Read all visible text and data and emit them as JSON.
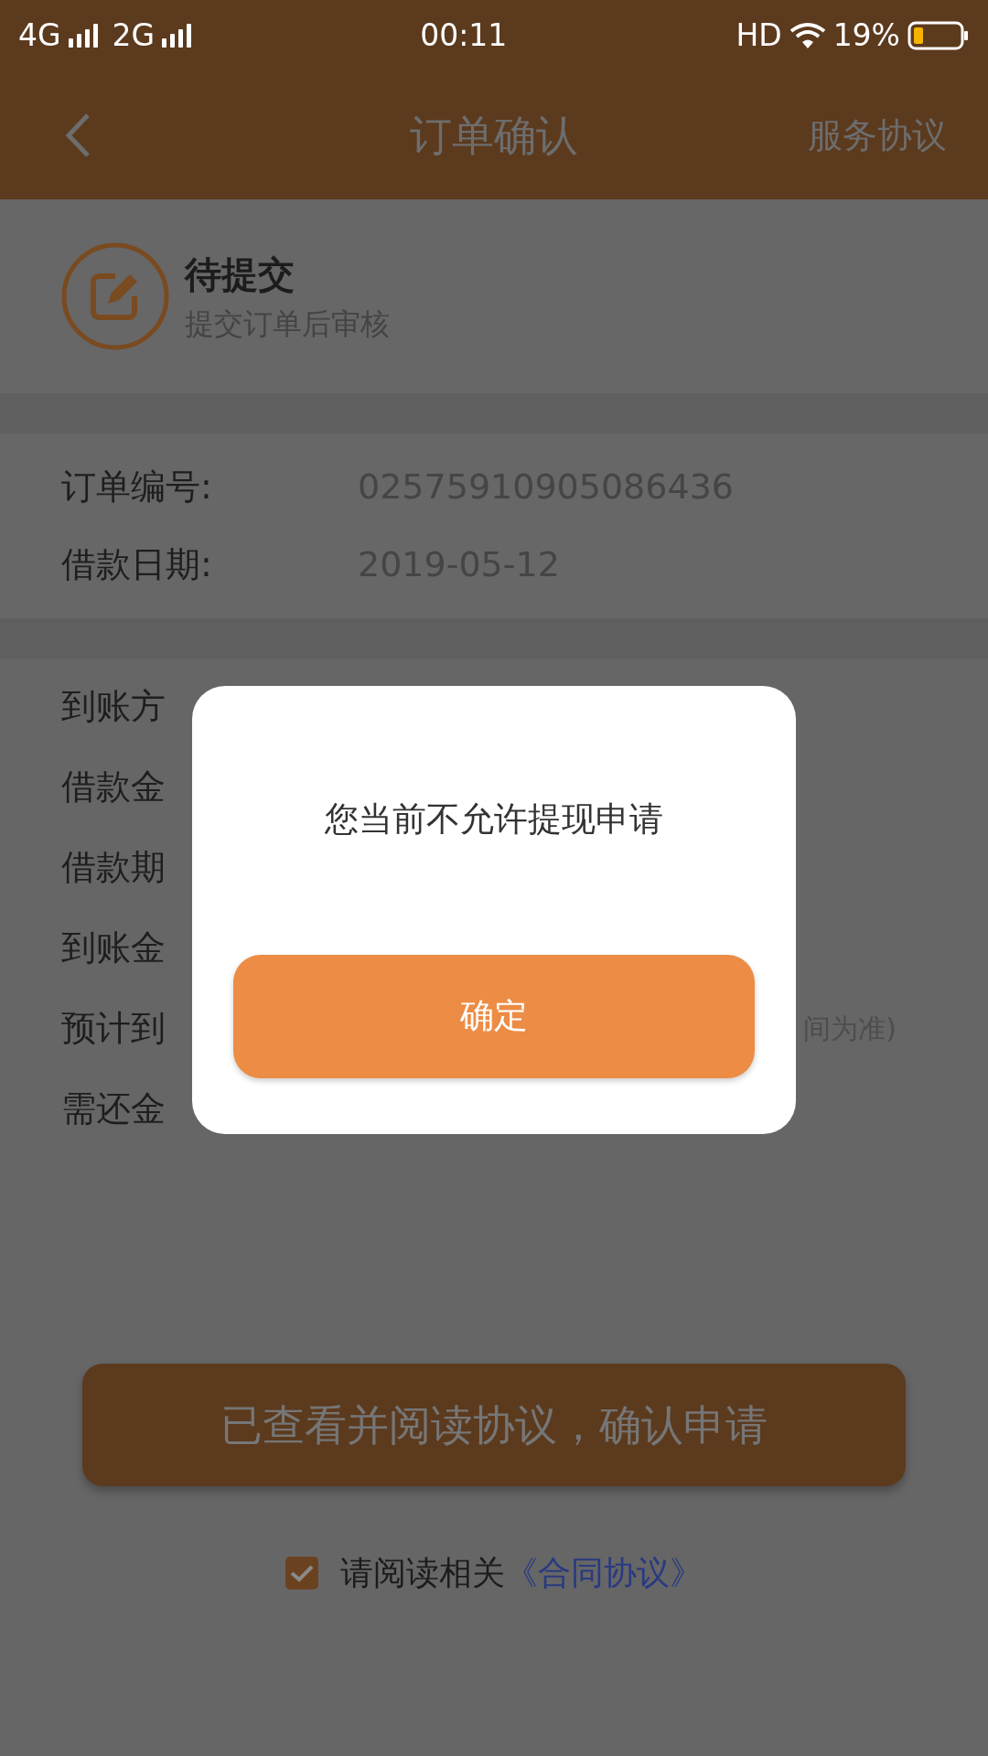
{
  "status_bar": {
    "network_1": "4G",
    "network_2": "2G",
    "time": "00:11",
    "hd": "HD",
    "battery": "19%"
  },
  "header": {
    "title": "订单确认",
    "action": "服务协议"
  },
  "order_status": {
    "title": "待提交",
    "subtitle": "提交订单后审核"
  },
  "order_info": [
    {
      "label": "订单编号:",
      "value": "02575910905086436"
    },
    {
      "label": "借款日期:",
      "value": "2019-05-12"
    }
  ],
  "details": [
    {
      "label": "到账方"
    },
    {
      "label": "借款金"
    },
    {
      "label": "借款期"
    },
    {
      "label": "到账金"
    },
    {
      "label": "预计到",
      "value": "间为准)"
    },
    {
      "label": "需还金"
    }
  ],
  "confirm_button": "已查看并阅读协议，确认申请",
  "agreement": {
    "checked": true,
    "text": "请阅读相关",
    "link": "《合同协议》"
  },
  "dialog": {
    "message": "您当前不允许提现申请",
    "button": "确定"
  }
}
